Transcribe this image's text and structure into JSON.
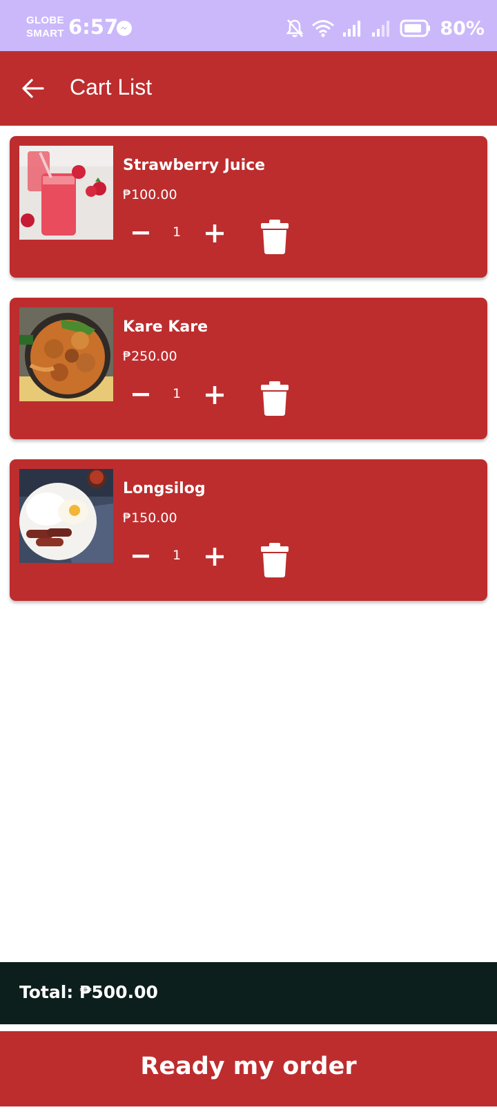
{
  "status_bar": {
    "carrier_line1": "GLOBE",
    "carrier_line2": "SMART",
    "time": "6:57",
    "battery": "80%",
    "icons": [
      "messenger-icon",
      "bell-muted-icon",
      "wifi-icon",
      "signal-icon",
      "signal-icon",
      "battery-icon"
    ]
  },
  "app_bar": {
    "title": "Cart List",
    "back_icon": "arrow-left-icon"
  },
  "cart": {
    "items": [
      {
        "name": "Strawberry Juice",
        "price": "₱100.00",
        "quantity": "1",
        "image": "strawberry-juice-photo"
      },
      {
        "name": "Kare Kare",
        "price": "₱250.00",
        "quantity": "1",
        "image": "kare-kare-photo"
      },
      {
        "name": "Longsilog",
        "price": "₱150.00",
        "quantity": "1",
        "image": "longsilog-photo"
      }
    ]
  },
  "total": {
    "label": "Total: ₱500.00"
  },
  "order_button": {
    "label": "Ready my order"
  },
  "colors": {
    "status_bar": "#cbb8fb",
    "primary": "#bd2d2e",
    "total_bar": "#0c1f1c",
    "text_on_primary": "#ffffff"
  }
}
